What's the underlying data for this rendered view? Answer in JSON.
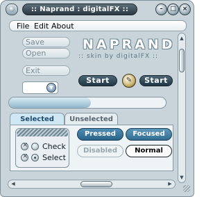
{
  "window": {
    "title": ":: Naprand : digitalFX ::",
    "controls": {
      "minimize": "–",
      "maximize": "□",
      "close": "×"
    }
  },
  "menu": {
    "file": "File",
    "edit": "Edit",
    "about": "About"
  },
  "side_buttons": {
    "save": "Save",
    "open": "Open",
    "exit": "Exit"
  },
  "logo": {
    "name": "NAPRAND",
    "subtitle": ":: skin by digitalFX ::"
  },
  "start_buttons": {
    "left": "Start",
    "right": "Start"
  },
  "combo": {
    "value": ""
  },
  "progress": {
    "fraction": 0.52
  },
  "tabs": {
    "selected": "Selected",
    "unselected": "Unselected"
  },
  "options": {
    "check": "Check",
    "select": "Select"
  },
  "state_buttons": {
    "pressed": "Pressed",
    "focused": "Focused",
    "disabled": "Disabled",
    "normal": "Normal"
  },
  "icons": {
    "system": "app-icon",
    "tool": "pencil-icon"
  }
}
